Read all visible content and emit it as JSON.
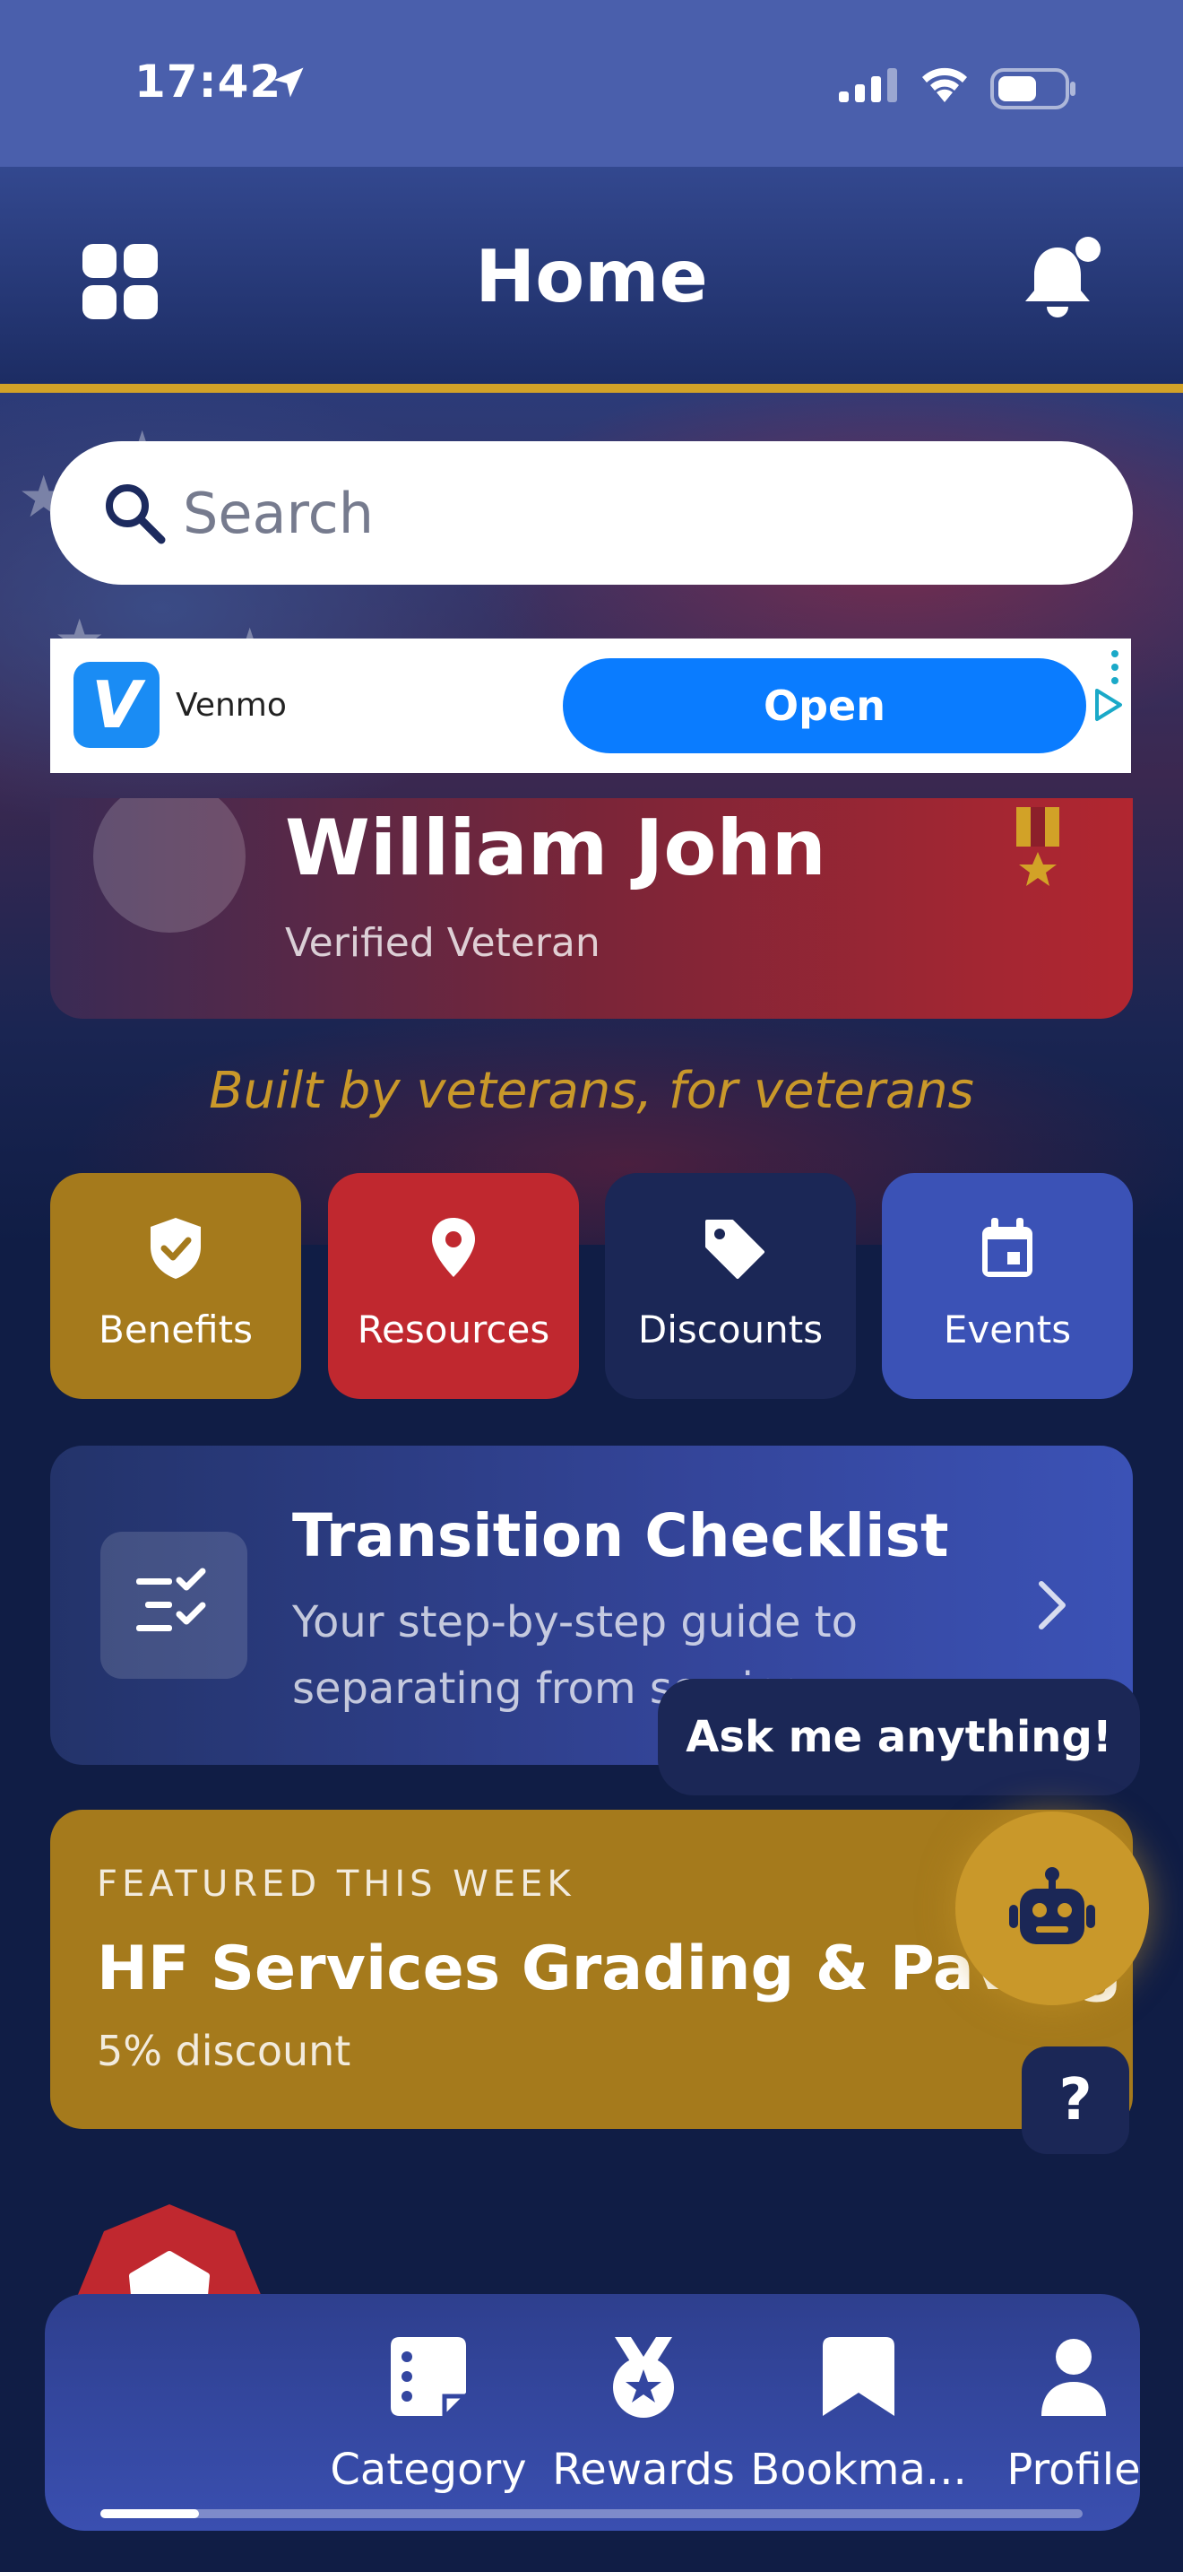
{
  "status_bar": {
    "time": "17:42",
    "battery_level": 0.6
  },
  "header": {
    "title": "Home"
  },
  "search": {
    "placeholder": "Search"
  },
  "ad": {
    "advertiser": "Venmo",
    "logo_letter": "V",
    "cta": "Open"
  },
  "profile": {
    "name": "William John",
    "status": "Verified Veteran"
  },
  "tagline": "Built by veterans, for veterans",
  "quick_actions": [
    {
      "label": "Benefits",
      "icon": "shield-check-icon",
      "color": "#a57a1c"
    },
    {
      "label": "Resources",
      "icon": "map-pin-icon",
      "color": "#c0282f"
    },
    {
      "label": "Discounts",
      "icon": "tag-icon",
      "color": "#1b2756"
    },
    {
      "label": "Events",
      "icon": "calendar-icon",
      "color": "#3b52b6"
    }
  ],
  "checklist": {
    "title": "Transition Checklist",
    "description": "Your step-by-step guide to separating from service"
  },
  "assistant": {
    "bubble": "Ask me anything!",
    "help_label": "?"
  },
  "featured": {
    "eyebrow": "FEATURED THIS WEEK",
    "title": "HF Services Grading & Paving",
    "subtitle": "5% discount"
  },
  "tabs": [
    {
      "label": "Category",
      "icon": "category-icon"
    },
    {
      "label": "Rewards",
      "icon": "medal-icon"
    },
    {
      "label": "Bookma...",
      "icon": "bookmark-icon"
    },
    {
      "label": "Profile",
      "icon": "person-icon"
    }
  ],
  "tab_progress": 0.1,
  "colors": {
    "gold": "#c9982a",
    "navy": "#101d45",
    "red": "#c0282f",
    "blue": "#3b52b6"
  }
}
